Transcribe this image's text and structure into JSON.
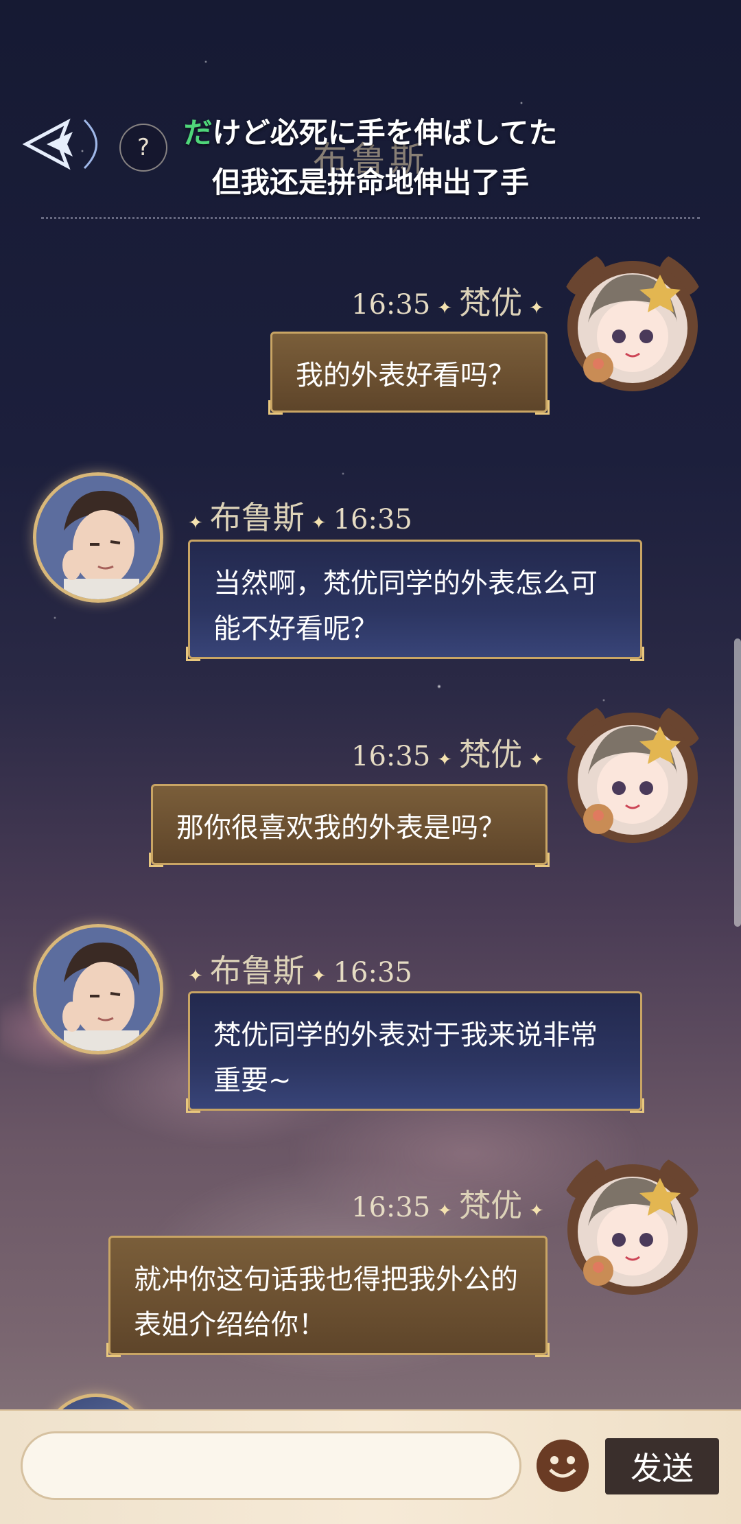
{
  "header": {
    "title": "布鲁斯",
    "help_label": "?",
    "subtitle_jp_highlight": "だ",
    "subtitle_jp_rest": "けど必死に手を伸ばしてた",
    "subtitle_cn": "但我还是拼命地伸出了手"
  },
  "messages": [
    {
      "sender": "梵优",
      "time": "16:35",
      "text": "我的外表好看吗？",
      "side": "right"
    },
    {
      "sender": "布鲁斯",
      "time": "16:35",
      "text": "当然啊，梵优同学的外表怎么可能不好看呢？",
      "side": "left"
    },
    {
      "sender": "梵优",
      "time": "16:35",
      "text": "那你很喜欢我的外表是吗？",
      "side": "right"
    },
    {
      "sender": "布鲁斯",
      "time": "16:35",
      "text": "梵优同学的外表对于我来说非常重要~",
      "side": "left"
    },
    {
      "sender": "梵优",
      "time": "16:35",
      "text": "就冲你这句话我也得把我外公的表姐介绍给你！",
      "side": "right"
    }
  ],
  "input": {
    "placeholder": "",
    "send_label": "发送"
  },
  "colors": {
    "accent_gold": "#c9a564",
    "subtitle_green": "#4fd67a",
    "send_bg": "#3a2f2c"
  }
}
